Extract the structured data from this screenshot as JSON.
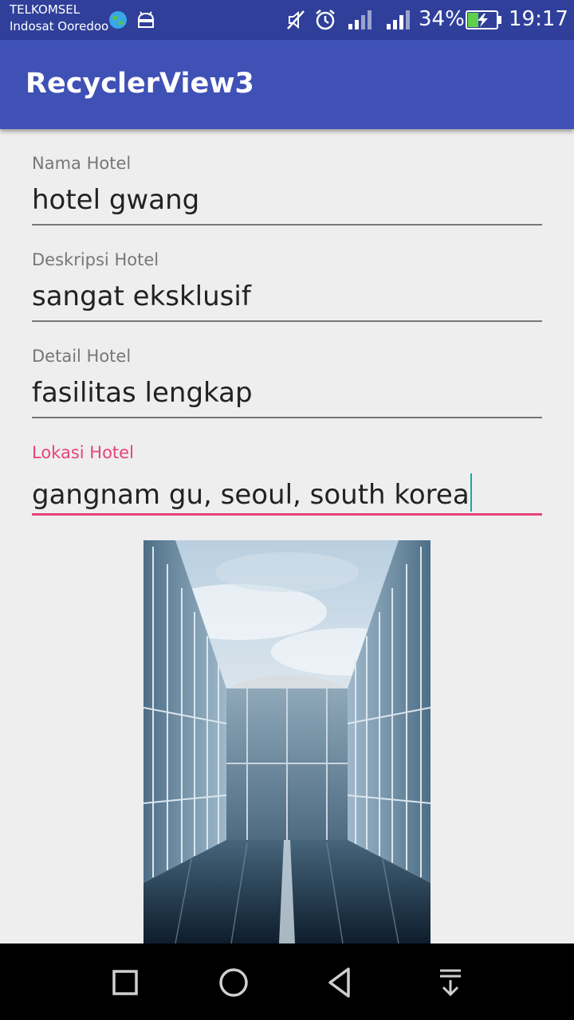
{
  "status_bar": {
    "carrier_1": "TELKOMSEL",
    "carrier_2": "Indosat Ooredoo",
    "battery_percent": "34%",
    "time": "19:17"
  },
  "app_bar": {
    "title": "RecyclerView3"
  },
  "form": {
    "fields": [
      {
        "label": "Nama Hotel",
        "value": "hotel gwang"
      },
      {
        "label": "Deskripsi Hotel",
        "value": "sangat eksklusif"
      },
      {
        "label": "Detail Hotel",
        "value": "fasilitas lengkap"
      },
      {
        "label": "Lokasi Hotel",
        "value": "gangnam gu, seoul, south korea"
      }
    ],
    "active_field_index": 3
  },
  "colors": {
    "status_bar": "#2f3f9a",
    "app_bar": "#3f51b5",
    "accent": "#e8417c",
    "background": "#eeeeee"
  },
  "icons": {
    "status": [
      "globe-icon",
      "android-debug-icon",
      "mute-icon",
      "alarm-icon",
      "signal-icon",
      "signal-icon",
      "battery-charging-icon"
    ],
    "navigation": [
      "recent-apps-icon",
      "home-icon",
      "back-icon",
      "notification-pull-icon"
    ]
  }
}
